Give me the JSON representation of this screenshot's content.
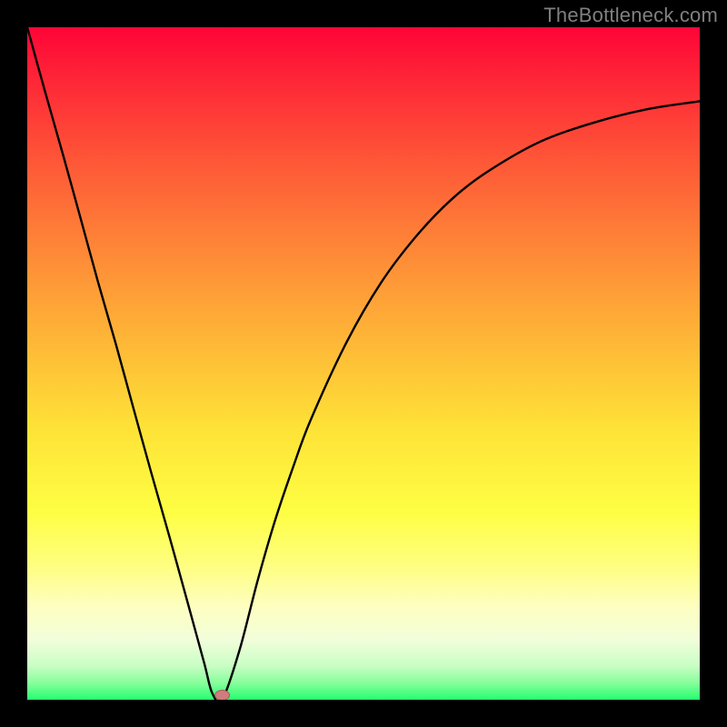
{
  "watermark": "TheBottleneck.com",
  "colors": {
    "background": "#000000",
    "curve": "#000000",
    "marker_fill": "#cf7c7e",
    "marker_stroke": "#b2595a",
    "gradient_stops": [
      {
        "offset": 0.0,
        "color": "#fe0537"
      },
      {
        "offset": 0.1,
        "color": "#fe2f37"
      },
      {
        "offset": 0.2,
        "color": "#fe5737"
      },
      {
        "offset": 0.3,
        "color": "#fe7c37"
      },
      {
        "offset": 0.4,
        "color": "#fea037"
      },
      {
        "offset": 0.5,
        "color": "#fec237"
      },
      {
        "offset": 0.6,
        "color": "#fee337"
      },
      {
        "offset": 0.72,
        "color": "#fefe43"
      },
      {
        "offset": 0.8,
        "color": "#fefe80"
      },
      {
        "offset": 0.86,
        "color": "#fefebf"
      },
      {
        "offset": 0.91,
        "color": "#f2feda"
      },
      {
        "offset": 0.95,
        "color": "#c8fec4"
      },
      {
        "offset": 0.975,
        "color": "#86fe9b"
      },
      {
        "offset": 1.0,
        "color": "#26fe6f"
      }
    ]
  },
  "chart_data": {
    "type": "line",
    "title": "",
    "xlabel": "",
    "ylabel": "",
    "xlim": [
      0,
      100
    ],
    "ylim": [
      0,
      100
    ],
    "series": [
      {
        "name": "bottleneck-curve",
        "x": [
          0.0,
          2.6,
          5.3,
          7.9,
          10.5,
          13.2,
          15.8,
          18.4,
          21.1,
          23.7,
          26.3,
          27.5,
          29.0,
          31.6,
          34.2,
          36.8,
          39.5,
          42.1,
          47.4,
          52.6,
          57.9,
          63.2,
          68.4,
          76.3,
          84.2,
          92.1,
          100.0
        ],
        "y": [
          100.0,
          90.6,
          81.1,
          71.7,
          62.2,
          52.8,
          43.3,
          33.9,
          24.4,
          15.0,
          5.5,
          1.0,
          0.0,
          7.5,
          17.5,
          26.5,
          34.5,
          41.5,
          53.0,
          62.0,
          69.0,
          74.5,
          78.5,
          83.0,
          85.8,
          87.8,
          89.0
        ]
      }
    ],
    "marker": {
      "x": 29.0,
      "y": 0.0
    }
  }
}
